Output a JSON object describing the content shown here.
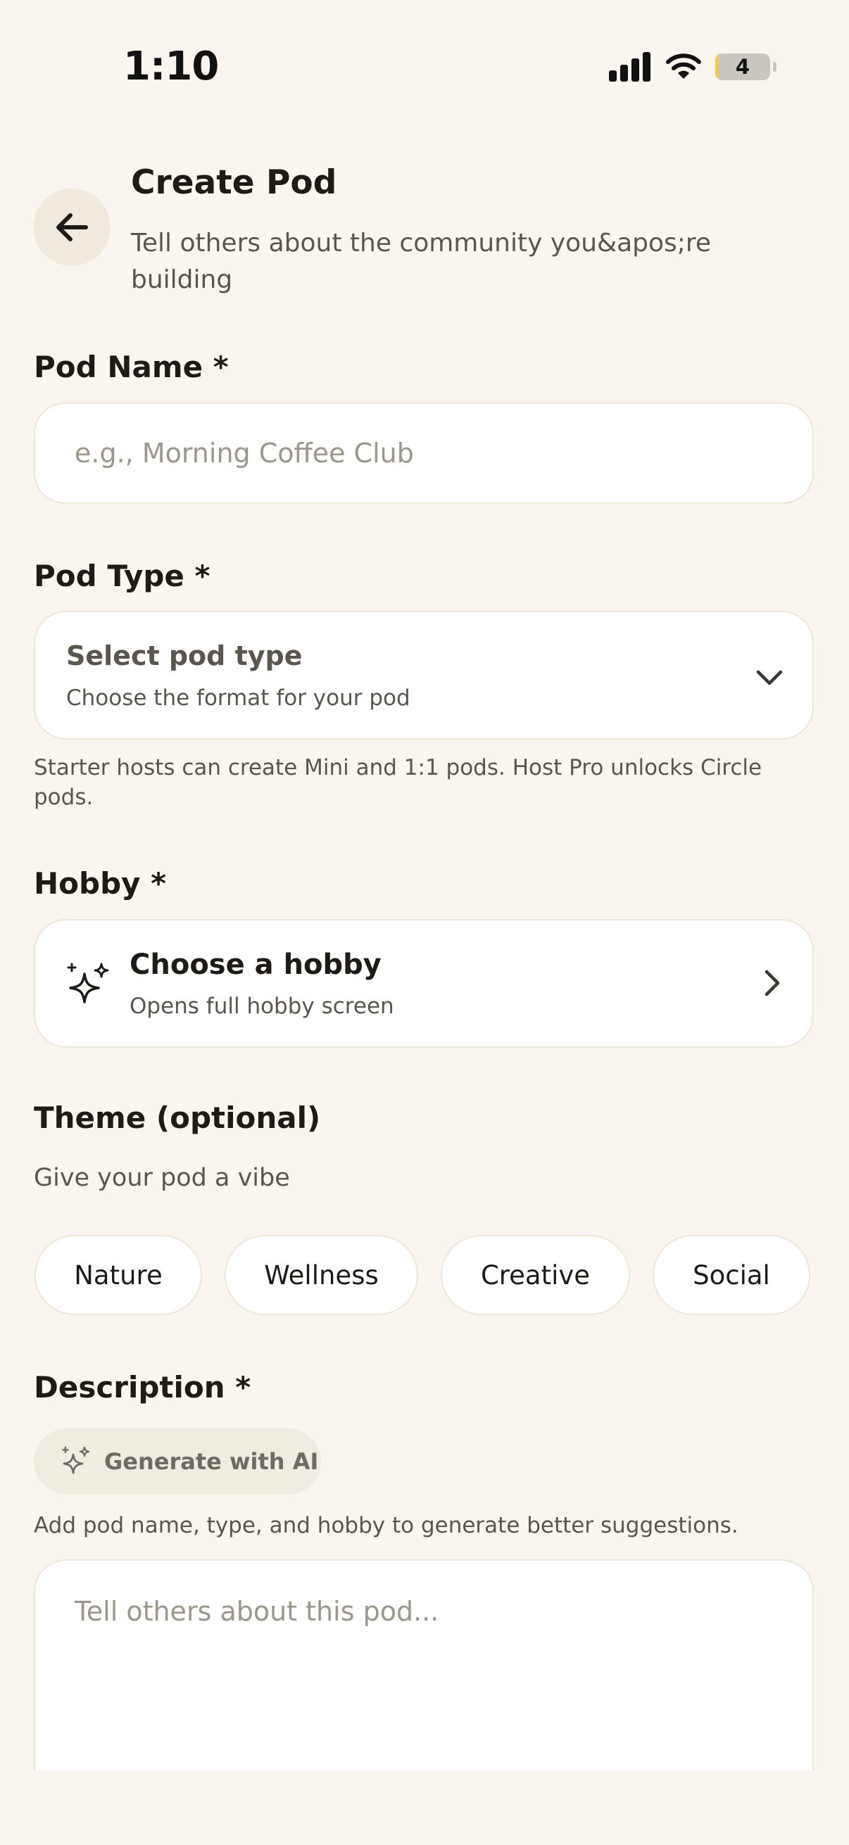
{
  "status_bar": {
    "time": "1:10",
    "battery_level": "4",
    "battery_fill_fraction": 0.04,
    "battery_fill_color": "#F2C94C"
  },
  "header": {
    "title": "Create Pod",
    "subtitle": "Tell others about the community you&apos;re building",
    "back_icon": "arrow-left-icon"
  },
  "form": {
    "pod_name": {
      "label": "Pod Name *",
      "placeholder": "e.g., Morning Coffee Club",
      "value": ""
    },
    "pod_type": {
      "label": "Pod Type *",
      "select_title": "Select pod type",
      "select_subtitle": "Choose the format for your pod",
      "helper": "Starter hosts can create Mini and 1:1 pods. Host Pro unlocks Circle pods.",
      "icon": "chevron-down-icon"
    },
    "hobby": {
      "label": "Hobby *",
      "title": "Choose a hobby",
      "subtitle": "Opens full hobby screen",
      "icons": [
        "sparkle-icon",
        "chevron-right-icon"
      ]
    },
    "theme": {
      "label": "Theme (optional)",
      "subtitle": "Give your pod a vibe",
      "options": [
        "Nature",
        "Wellness",
        "Creative",
        "Social"
      ]
    },
    "description": {
      "label": "Description *",
      "ai_button_label": "Generate with AI",
      "helper": "Add pod name, type, and hobby to generate better suggestions.",
      "placeholder": "Tell others about this pod..."
    }
  },
  "colors": {
    "background": "#FAF6EF",
    "card": "#FFFFFF",
    "text_primary": "#1E1B17",
    "text_secondary": "#5A554D",
    "placeholder": "#9C968B",
    "chip_border": "#EDE7DA"
  }
}
